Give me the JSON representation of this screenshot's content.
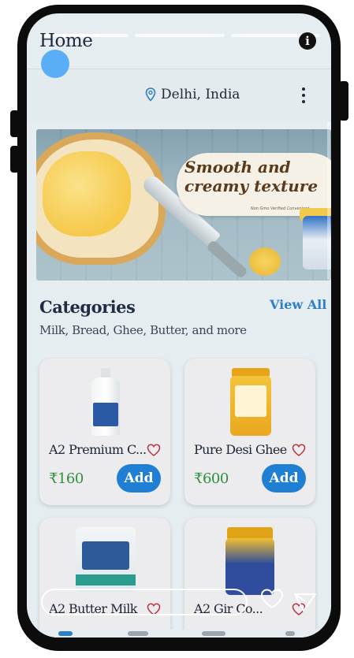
{
  "story": {
    "bars": [
      {
        "fill": 0.68
      },
      {
        "fill": 0
      },
      {
        "fill": 0
      }
    ]
  },
  "header": {
    "title": "Home",
    "info_icon": "info-icon",
    "location": "Delhi, India",
    "more_icon": "more-vertical-icon"
  },
  "banner": {
    "headline": "Smooth and creamy texture",
    "tagline": "Non Gmo Verified Convenient"
  },
  "categories": {
    "title": "Categories",
    "view_all": "View All",
    "subtitle": "Milk, Bread, Ghee, Butter, and more"
  },
  "products": [
    {
      "name": "A2 Premium C...",
      "price": "₹160",
      "add_label": "Add",
      "image": "milk-bottle"
    },
    {
      "name": "Pure Desi Ghee",
      "price": "₹600",
      "add_label": "Add",
      "image": "ghee-jar"
    },
    {
      "name": "A2 Butter Milk",
      "price": "",
      "add_label": "",
      "image": "milk-pouch"
    },
    {
      "name": "A2 Gir Co...",
      "price": "",
      "add_label": "",
      "image": "gir-ghee-jar"
    }
  ],
  "colors": {
    "accent": "#1f7fd4",
    "price": "#2e8f3d",
    "heart": "#b7333d",
    "touch": "#5aaef5"
  }
}
